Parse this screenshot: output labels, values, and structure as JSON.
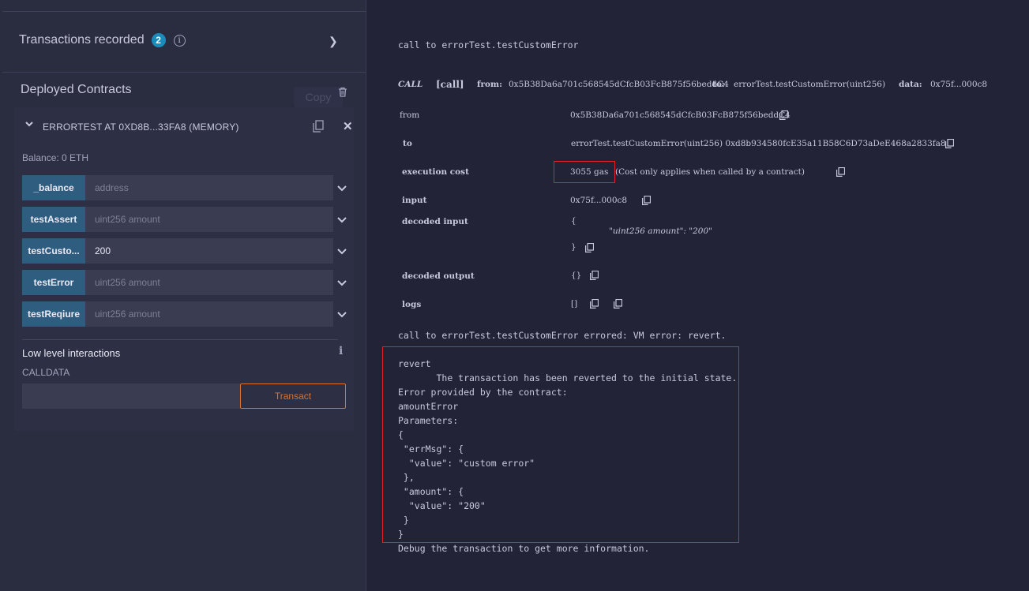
{
  "left_panel": {
    "transactions_recorded": {
      "label": "Transactions recorded",
      "count": "2"
    },
    "deployed_contracts": {
      "title": "Deployed Contracts",
      "copy_tooltip": "Copy"
    },
    "contract": {
      "title": "ERRORTEST AT 0XD8B...33FA8 (MEMORY)",
      "balance": "Balance: 0 ETH",
      "functions": [
        {
          "name": "_balance",
          "placeholder": "address",
          "value": ""
        },
        {
          "name": "testAssert",
          "placeholder": "uint256 amount",
          "value": ""
        },
        {
          "name": "testCusto...",
          "placeholder": "",
          "value": "200"
        },
        {
          "name": "testError",
          "placeholder": "uint256 amount",
          "value": ""
        },
        {
          "name": "testReqiure",
          "placeholder": "uint256 amount",
          "value": ""
        }
      ]
    },
    "low_level": {
      "title": "Low level interactions",
      "calldata_label": "CALLDATA",
      "transact_label": "Transact"
    }
  },
  "terminal": {
    "call_line": "call to errorTest.testCustomError",
    "summary": {
      "tag": "CALL",
      "kind": "[call]",
      "from_label": "from:",
      "from": "0x5B38Da6a701c568545dCfcB03FcB875f56beddC4",
      "to_label": "to:",
      "to": "errorTest.testCustomError(uint256)",
      "data_label": "data:",
      "data": "0x75f...000c8"
    },
    "details": {
      "from_label": "from",
      "from_value": "0x5B38Da6a701c568545dCfcB03FcB875f56beddC4",
      "to_label": "to",
      "to_value": "errorTest.testCustomError(uint256) 0xd8b934580fcE35a11B58C6D73aDeE468a2833fa8",
      "cost_label": "execution cost",
      "cost_value": "3055 gas",
      "cost_note": "(Cost only applies when called by a contract)",
      "input_label": "input",
      "input_value": "0x75f...000c8",
      "decoded_input_label": "decoded input",
      "decoded_input_open": "{",
      "decoded_input_line": "\"uint256 amount\": \"200\"",
      "decoded_input_close": "}",
      "decoded_output_label": "decoded output",
      "decoded_output_value": "{}",
      "logs_label": "logs",
      "logs_value": "[]"
    },
    "error_line": "call to errorTest.testCustomError errored: VM error: revert.",
    "revert_lines": [
      "revert",
      "\tThe transaction has been reverted to the initial state.",
      "Error provided by the contract:",
      "amountError",
      "Parameters:",
      "{",
      " \"errMsg\": {",
      "  \"value\": \"custom error\"",
      " },",
      " \"amount\": {",
      "  \"value\": \"200\"",
      " }",
      "}"
    ],
    "debug_line": "Debug the transaction to get more information."
  },
  "colors": {
    "accent": "#d9722f",
    "button": "#2f5d7f",
    "badge": "#1a8cbb",
    "highlight": "#e0202c"
  }
}
